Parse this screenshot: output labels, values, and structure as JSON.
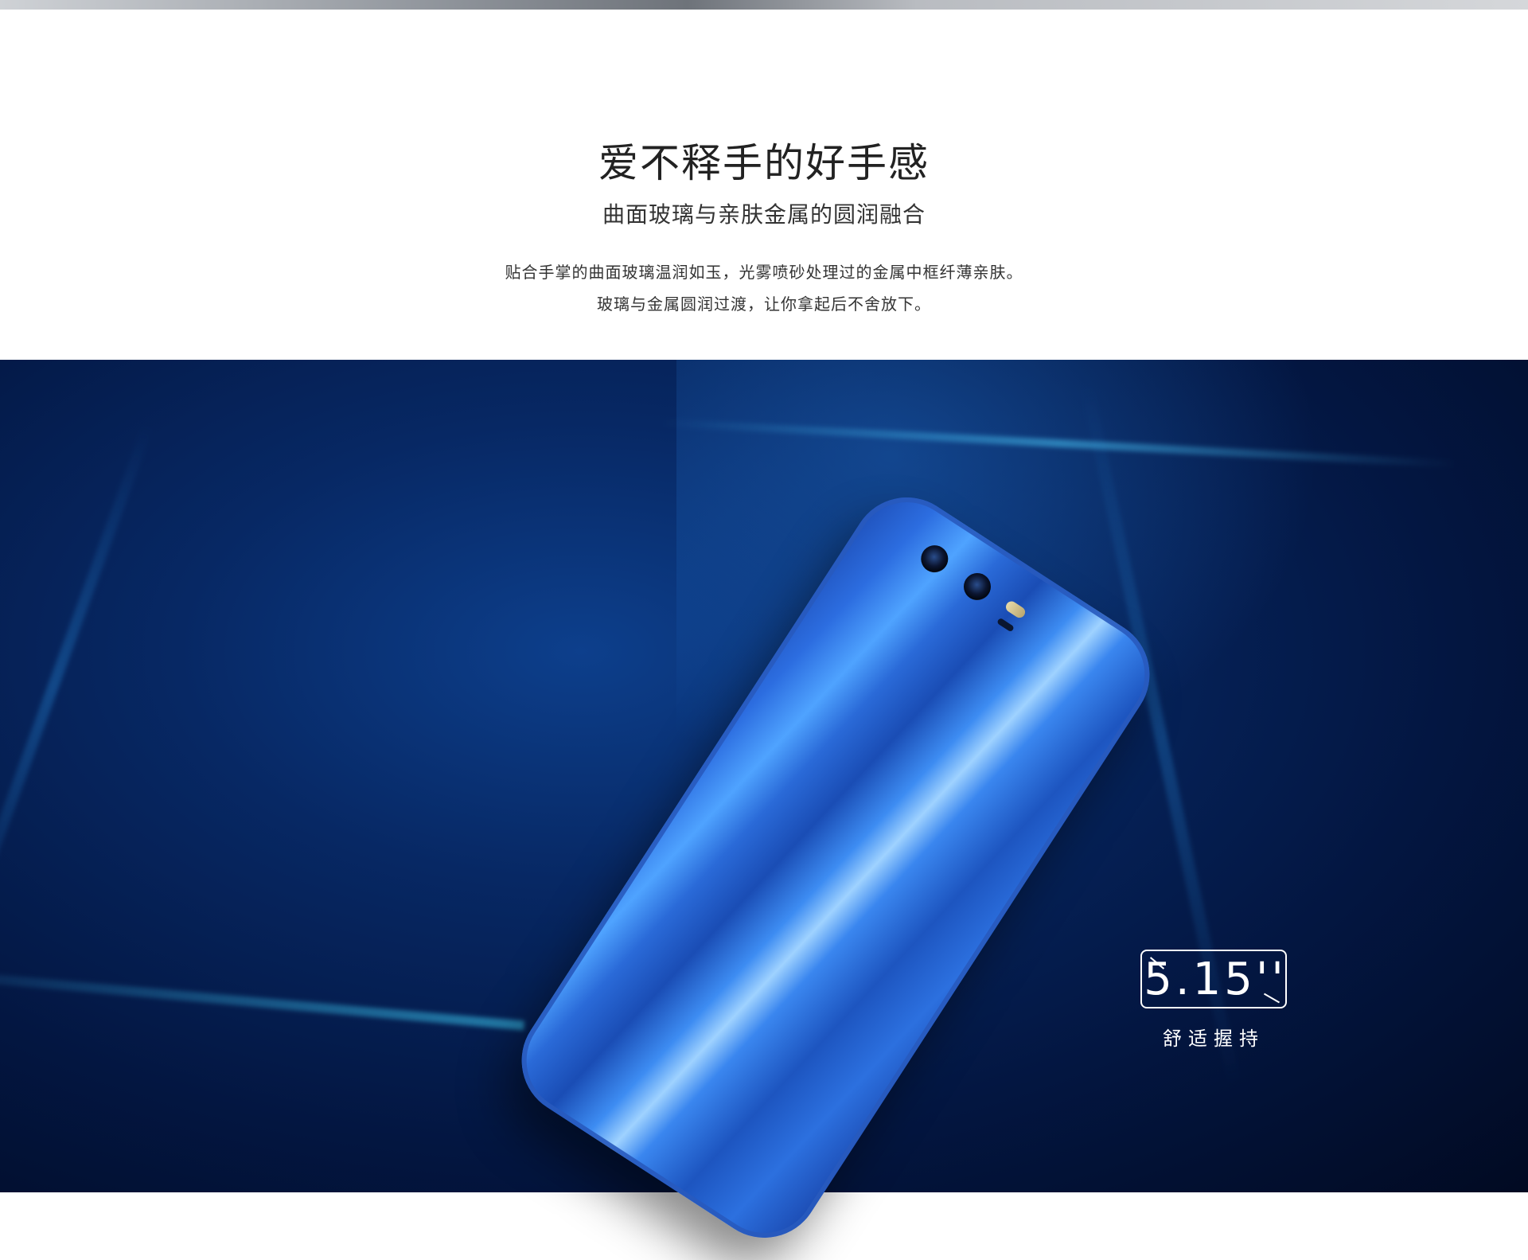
{
  "hero": {
    "headline": "爱不释手的好手感",
    "subheadline": "曲面玻璃与亲肤金属的圆润融合",
    "description_lines": [
      "贴合手掌的曲面玻璃温润如玉，光雾喷砂处理过的金属中框纤薄亲肤。",
      "玻璃与金属圆润过渡，让你拿起后不舍放下。"
    ]
  },
  "spec": {
    "value": "5.15''",
    "label": "舒适握持"
  },
  "colors": {
    "phone_blue": "#2c6de0",
    "scene_dark": "#031641",
    "text_dark": "#222222"
  }
}
